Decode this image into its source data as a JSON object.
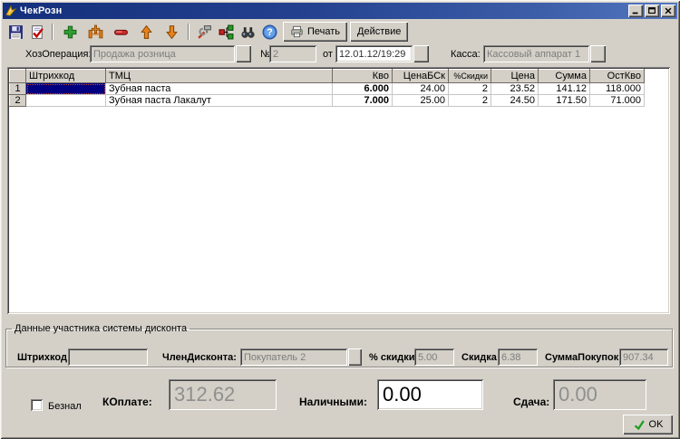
{
  "window": {
    "title": "ЧекРозн"
  },
  "toolbar": {
    "print_label": "Печать",
    "action_label": "Действие",
    "icon_buttons": [
      "save-icon",
      "verify-icon",
      "add-icon",
      "insert-icon",
      "delete-icon",
      "move-up-icon",
      "move-down-icon",
      "settings-icon",
      "structure-icon",
      "search-icon",
      "help-icon"
    ]
  },
  "icons": {
    "app-icon": "yellow app logo",
    "minimize-icon": "minimize bar",
    "maximize-icon": "maximize square",
    "close-icon": "close cross",
    "save-icon": "floppy disk",
    "verify-icon": "document with red check",
    "add-icon": "green plus",
    "insert-icon": "orange insert plus",
    "delete-icon": "red bar",
    "move-up-icon": "orange arrow up",
    "move-down-icon": "orange arrow down",
    "settings-icon": "hammer and wrench",
    "structure-icon": "linked colored squares",
    "search-icon": "binoculars",
    "help-icon": "blue question circle",
    "printer-icon": "printer",
    "check-icon": "green checkmark"
  },
  "form": {
    "operation_label": "ХозОперация:",
    "operation_value": "Продажа розница",
    "number_label": "№",
    "number_value": "2",
    "date_label": "от",
    "date_value": "12.01.12/19:29",
    "cashbox_label": "Касса:",
    "cashbox_value": "Кассовый аппарат 1"
  },
  "table": {
    "headers": {
      "barcode": "Штрихкод",
      "tmc": "ТМЦ",
      "qty": "Кво",
      "price_nodisc": "ЦенаБСк",
      "disc": "%Скидки",
      "price": "Цена",
      "sum": "Сумма",
      "rest": "ОстКво"
    },
    "rows": [
      {
        "num": "1",
        "barcode": "",
        "tmc": "Зубная паста",
        "qty": "6.000",
        "price_nodisc": "24.00",
        "disc": "2",
        "price": "23.52",
        "sum": "141.12",
        "rest": "118.000"
      },
      {
        "num": "2",
        "barcode": "",
        "tmc": "Зубная паста Лакалут",
        "qty": "7.000",
        "price_nodisc": "25.00",
        "disc": "2",
        "price": "24.50",
        "sum": "171.50",
        "rest": "71.000"
      }
    ]
  },
  "discount": {
    "group_title": "Данные участника системы дисконта",
    "barcode_label": "Штрихкод:",
    "barcode_value": "",
    "member_label": "ЧленДисконта:",
    "member_value": "Покупатель 2",
    "pct_label": "% скидки:",
    "pct_value": "5.00",
    "discount_label": "Скидка:",
    "discount_value": "6.38",
    "purchases_label": "СуммаПокупок:",
    "purchases_value": "907.34"
  },
  "payment": {
    "cashless_label": "Безнал",
    "to_pay_label": "КОплате:",
    "to_pay_value": "312.62",
    "cash_label": "Наличными:",
    "cash_value": "0.00",
    "change_label": "Сдача:",
    "change_value": "0.00"
  },
  "footer": {
    "ok_label": "OK"
  }
}
